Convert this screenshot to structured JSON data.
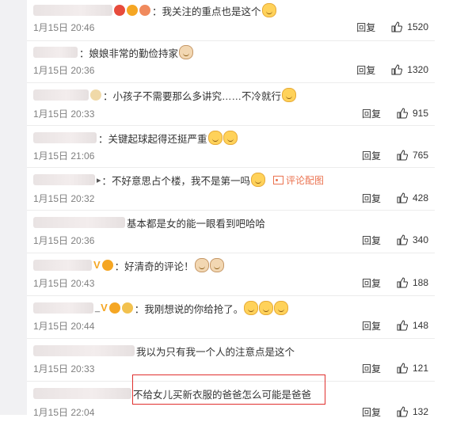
{
  "comments": [
    {
      "text": "：我关注的重点也是这个",
      "date": "1月15日 20:46",
      "reply": "回复",
      "likes": "1520"
    },
    {
      "text": "：娘娘非常的勤俭持家",
      "date": "1月15日 20:36",
      "reply": "回复",
      "likes": "1320"
    },
    {
      "text": "：小孩子不需要那么多讲究……不冷就行",
      "date": "1月15日 20:33",
      "reply": "回复",
      "likes": "915"
    },
    {
      "text": "：关键起球起得还挺严重",
      "date": "1月15日 21:06",
      "reply": "回复",
      "likes": "765"
    },
    {
      "text": "：不好意思占个楼，我不是第一吗",
      "date": "1月15日 20:32",
      "reply": "回复",
      "likes": "428",
      "pic_link": "评论配图"
    },
    {
      "text": "基本都是女的能一眼看到吧哈哈",
      "date": "1月15日 20:36",
      "reply": "回复",
      "likes": "340"
    },
    {
      "text": "：好清奇的评论！",
      "date": "1月15日 20:43",
      "reply": "回复",
      "likes": "188"
    },
    {
      "text": "：我刚想说的你给抢了。",
      "date": "1月15日 20:44",
      "reply": "回复",
      "likes": "148"
    },
    {
      "text": "我以为只有我一个人的注意点是这个",
      "date": "1月15日 20:33",
      "reply": "回复",
      "likes": "121"
    },
    {
      "text": "不给女儿买新衣服的爸爸怎么可能是爸爸",
      "date": "1月15日 22:04",
      "reply": "回复",
      "likes": "132"
    }
  ]
}
